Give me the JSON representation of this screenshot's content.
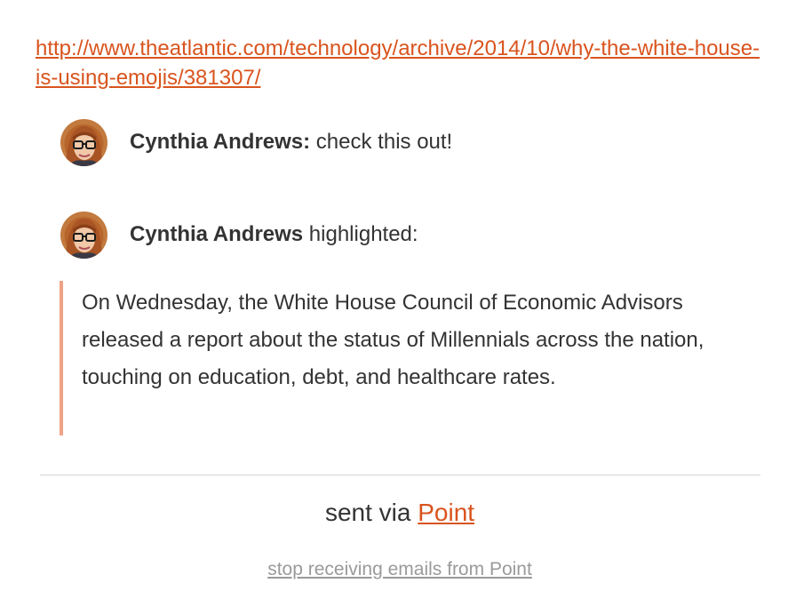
{
  "article": {
    "url": "http://www.theatlantic.com/technology/archive/2014/10/why-the-white-house-is-using-emojis/381307/"
  },
  "comments": [
    {
      "author": "Cynthia Andrews:",
      "text": " check this out!"
    },
    {
      "author": "Cynthia Andrews",
      "text": " highlighted:"
    }
  ],
  "highlight": {
    "text": "On Wednesday, the White House Council of Economic Advisors released a report about the status of Millennials across the nation, touching on education, debt, and healthcare rates."
  },
  "footer": {
    "sent_via_prefix": "sent via ",
    "point_link": "Point",
    "unsubscribe": "stop receiving emails from Point"
  },
  "colors": {
    "link": "#d9541e",
    "quote_border": "#f0a286",
    "muted": "#9a9a9a"
  }
}
